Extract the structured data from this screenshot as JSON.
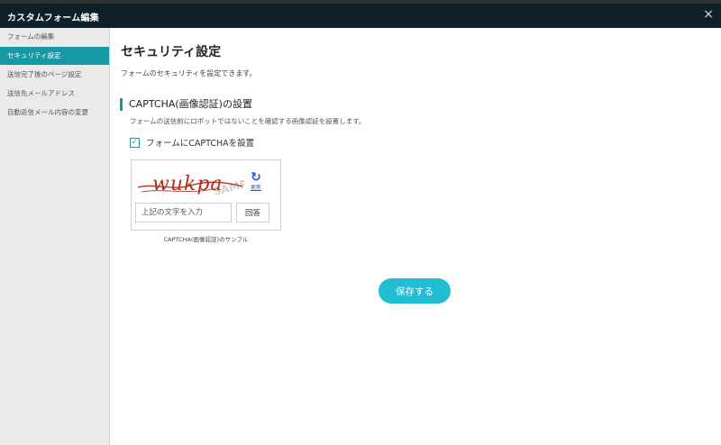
{
  "window": {
    "title": "カスタムフォーム編集",
    "close_glyph": "×"
  },
  "sidebar": {
    "items": [
      {
        "label": "フォームの編集",
        "active": false
      },
      {
        "label": "セキュリティ設定",
        "active": true
      },
      {
        "label": "送信完了後のページ設定",
        "active": false
      },
      {
        "label": "送信先メールアドレス",
        "active": false
      },
      {
        "label": "自動返信メール内容の変更",
        "active": false
      }
    ]
  },
  "main": {
    "title": "セキュリティ設定",
    "description": "フォームのセキュリティを設定できます。",
    "section": {
      "heading": "CAPTCHA(画像認証)の設置",
      "description": "フォームの送信前にロボットではないことを確認する画像認証を設置します。"
    },
    "checkbox": {
      "checked": true,
      "check_glyph": "✓",
      "label": "フォームにCAPTCHAを設置"
    },
    "captcha": {
      "image_text": "wukpa",
      "watermark": "SAMPLE",
      "refresh_glyph": "↻",
      "refresh_label": "更新",
      "input_placeholder": "上記の文字を入力",
      "answer_label": "回答",
      "caption": "CAPTCHA(画像認証)のサンプル"
    },
    "save_label": "保存する"
  },
  "colors": {
    "titlebar": "#10202a",
    "accent": "#159aa5",
    "save_button": "#22bcd3",
    "refresh_icon": "#1f5bd6",
    "captcha_text": "#b0301f"
  }
}
